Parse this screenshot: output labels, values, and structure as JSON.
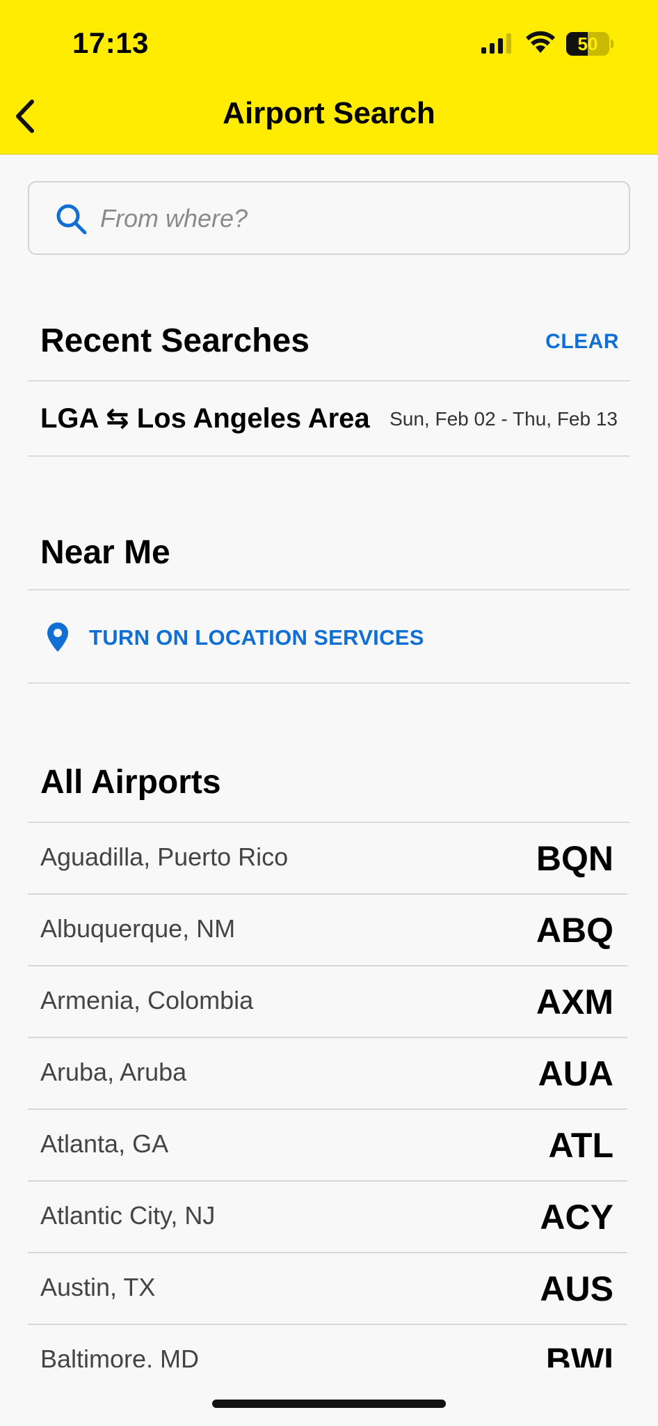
{
  "status_bar": {
    "time": "17:13",
    "battery": "50",
    "battery_fraction": 0.5
  },
  "header": {
    "title": "Airport Search",
    "back_icon": "chevron-left-icon",
    "background_color": "#ffec00"
  },
  "search": {
    "placeholder": "From where?",
    "value": "",
    "icon": "search-icon"
  },
  "recent_searches": {
    "title": "Recent Searches",
    "clear_label": "CLEAR",
    "items": [
      {
        "origin": "LGA",
        "arrow": "⇆",
        "destination": "Los Angeles Area",
        "dates": "Sun, Feb 02 - Thu, Feb 13"
      }
    ]
  },
  "near_me": {
    "title": "Near Me",
    "location_label": "TURN ON LOCATION SERVICES",
    "icon": "location-pin-icon"
  },
  "all_airports": {
    "title": "All Airports",
    "items": [
      {
        "city": "Aguadilla, Puerto Rico",
        "code": "BQN"
      },
      {
        "city": "Albuquerque, NM",
        "code": "ABQ"
      },
      {
        "city": "Armenia, Colombia",
        "code": "AXM"
      },
      {
        "city": "Aruba, Aruba",
        "code": "AUA"
      },
      {
        "city": "Atlanta, GA",
        "code": "ATL"
      },
      {
        "city": "Atlantic City, NJ",
        "code": "ACY"
      },
      {
        "city": "Austin, TX",
        "code": "AUS"
      },
      {
        "city": "Baltimore, MD",
        "code": "BWI"
      }
    ]
  },
  "colors": {
    "accent_blue": "#0f6fd4",
    "brand_yellow": "#ffec00"
  }
}
